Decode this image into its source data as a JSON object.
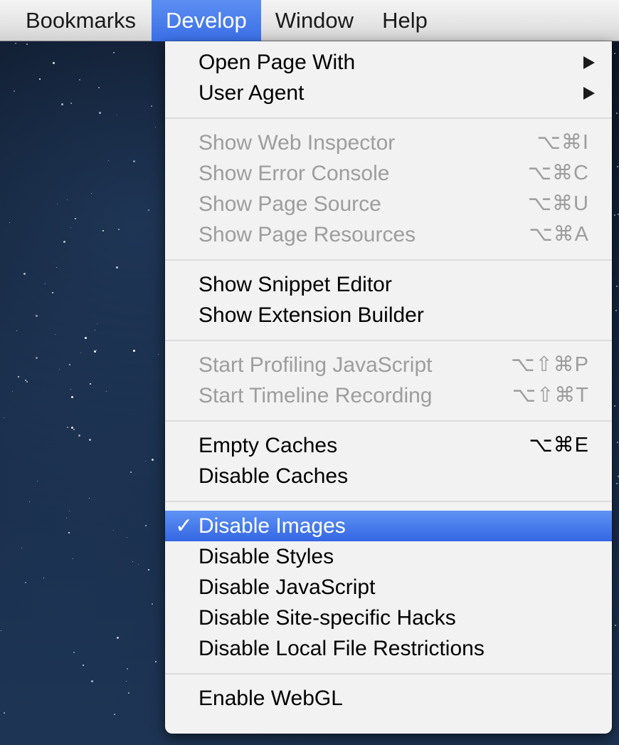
{
  "menubar": {
    "items": [
      {
        "label": "Bookmarks",
        "active": false
      },
      {
        "label": "Develop",
        "active": true
      },
      {
        "label": "Window",
        "active": false
      },
      {
        "label": "Help",
        "active": false
      }
    ]
  },
  "develop_menu": {
    "groups": [
      [
        {
          "label": "Open Page With",
          "submenu": true,
          "enabled": true
        },
        {
          "label": "User Agent",
          "submenu": true,
          "enabled": true
        }
      ],
      [
        {
          "label": "Show Web Inspector",
          "shortcut": "⌥⌘I",
          "enabled": false
        },
        {
          "label": "Show Error Console",
          "shortcut": "⌥⌘C",
          "enabled": false
        },
        {
          "label": "Show Page Source",
          "shortcut": "⌥⌘U",
          "enabled": false
        },
        {
          "label": "Show Page Resources",
          "shortcut": "⌥⌘A",
          "enabled": false
        }
      ],
      [
        {
          "label": "Show Snippet Editor",
          "enabled": true
        },
        {
          "label": "Show Extension Builder",
          "enabled": true
        }
      ],
      [
        {
          "label": "Start Profiling JavaScript",
          "shortcut": "⌥⇧⌘P",
          "enabled": false
        },
        {
          "label": "Start Timeline Recording",
          "shortcut": "⌥⇧⌘T",
          "enabled": false
        }
      ],
      [
        {
          "label": "Empty Caches",
          "shortcut": "⌥⌘E",
          "enabled": true
        },
        {
          "label": "Disable Caches",
          "enabled": true
        }
      ],
      [
        {
          "label": "Disable Images",
          "enabled": true,
          "checked": true,
          "highlighted": true
        },
        {
          "label": "Disable Styles",
          "enabled": true
        },
        {
          "label": "Disable JavaScript",
          "enabled": true
        },
        {
          "label": "Disable Site-specific Hacks",
          "enabled": true
        },
        {
          "label": "Disable Local File Restrictions",
          "enabled": true
        }
      ],
      [
        {
          "label": "Enable WebGL",
          "enabled": true
        }
      ]
    ],
    "check_mark": "✓"
  },
  "colors": {
    "highlight": "#3a6fe6",
    "disabled_text": "#9d9d9d"
  }
}
